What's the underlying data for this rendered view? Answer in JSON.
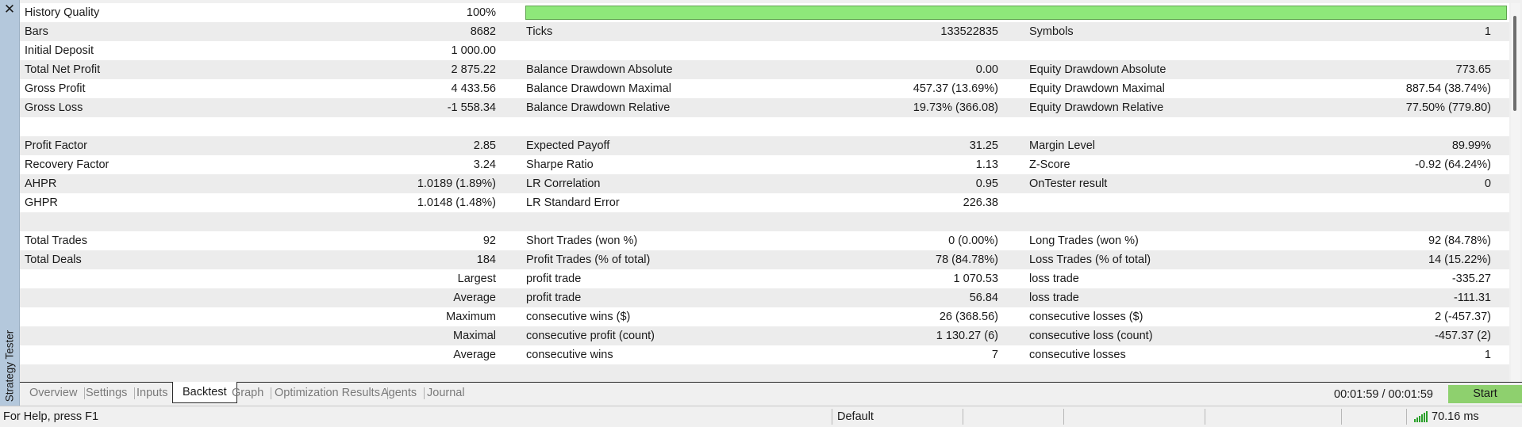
{
  "window": {
    "panel_title": "Strategy Tester",
    "close_glyph": "✕"
  },
  "report": {
    "rows": [
      {
        "l1": "History Quality",
        "v1": "100%",
        "l2": "",
        "v2": "",
        "l3": "",
        "v3": "",
        "bar": true,
        "quality_fraction": 1.0
      },
      {
        "l1": "Bars",
        "v1": "8682",
        "l2": "Ticks",
        "v2": "133522835",
        "l3": "Symbols",
        "v3": "1"
      },
      {
        "l1": "Initial Deposit",
        "v1": "1 000.00",
        "l2": "",
        "v2": "",
        "l3": "",
        "v3": ""
      },
      {
        "l1": "Total Net Profit",
        "v1": "2 875.22",
        "l2": "Balance Drawdown Absolute",
        "v2": "0.00",
        "l3": "Equity Drawdown Absolute",
        "v3": "773.65"
      },
      {
        "l1": "Gross Profit",
        "v1": "4 433.56",
        "l2": "Balance Drawdown Maximal",
        "v2": "457.37 (13.69%)",
        "l3": "Equity Drawdown Maximal",
        "v3": "887.54 (38.74%)"
      },
      {
        "l1": "Gross Loss",
        "v1": "-1 558.34",
        "l2": "Balance Drawdown Relative",
        "v2": "19.73% (366.08)",
        "l3": "Equity Drawdown Relative",
        "v3": "77.50% (779.80)"
      },
      {
        "l1": "",
        "v1": "",
        "l2": "",
        "v2": "",
        "l3": "",
        "v3": ""
      },
      {
        "l1": "Profit Factor",
        "v1": "2.85",
        "l2": "Expected Payoff",
        "v2": "31.25",
        "l3": "Margin Level",
        "v3": "89.99%"
      },
      {
        "l1": "Recovery Factor",
        "v1": "3.24",
        "l2": "Sharpe Ratio",
        "v2": "1.13",
        "l3": "Z-Score",
        "v3": "-0.92 (64.24%)"
      },
      {
        "l1": "AHPR",
        "v1": "1.0189 (1.89%)",
        "l2": "LR Correlation",
        "v2": "0.95",
        "l3": "OnTester result",
        "v3": "0"
      },
      {
        "l1": "GHPR",
        "v1": "1.0148 (1.48%)",
        "l2": "LR Standard Error",
        "v2": "226.38",
        "l3": "",
        "v3": ""
      },
      {
        "l1": "",
        "v1": "",
        "l2": "",
        "v2": "",
        "l3": "",
        "v3": ""
      },
      {
        "l1": "Total Trades",
        "v1": "92",
        "l2": "Short Trades (won %)",
        "v2": "0 (0.00%)",
        "l3": "Long Trades (won %)",
        "v3": "92 (84.78%)"
      },
      {
        "l1": "Total Deals",
        "v1": "184",
        "l2": "Profit Trades (% of total)",
        "v2": "78 (84.78%)",
        "l3": "Loss Trades (% of total)",
        "v3": "14 (15.22%)"
      },
      {
        "l1": "",
        "v1": "Largest",
        "l2": "profit trade",
        "v2": "1 070.53",
        "l3": "loss trade",
        "v3": "-335.27"
      },
      {
        "l1": "",
        "v1": "Average",
        "l2": "profit trade",
        "v2": "56.84",
        "l3": "loss trade",
        "v3": "-111.31"
      },
      {
        "l1": "",
        "v1": "Maximum",
        "l2": "consecutive wins ($)",
        "v2": "26 (368.56)",
        "l3": "consecutive losses ($)",
        "v3": "2 (-457.37)"
      },
      {
        "l1": "",
        "v1": "Maximal",
        "l2": "consecutive profit (count)",
        "v2": "1 130.27 (6)",
        "l3": "consecutive loss (count)",
        "v3": "-457.37 (2)"
      },
      {
        "l1": "",
        "v1": "Average",
        "l2": "consecutive wins",
        "v2": "7",
        "l3": "consecutive losses",
        "v3": "1"
      },
      {
        "l1": "",
        "v1": "",
        "l2": "",
        "v2": "",
        "l3": "",
        "v3": ""
      }
    ]
  },
  "tabs": [
    {
      "label": "Overview",
      "active": false
    },
    {
      "label": "Settings",
      "active": false
    },
    {
      "label": "Inputs",
      "active": false
    },
    {
      "label": "Backtest",
      "active": true
    },
    {
      "label": "Graph",
      "active": false
    },
    {
      "label": "Optimization Results",
      "active": false
    },
    {
      "label": "Agents",
      "active": false
    },
    {
      "label": "Journal",
      "active": false
    }
  ],
  "timer": "00:01:59 / 00:01:59",
  "start_button": "Start",
  "statusbar": {
    "help": "For Help, press F1",
    "profile": "Default",
    "ping": "70.16 ms"
  },
  "colors": {
    "quality_bar": "#8ee87a",
    "start_button": "#8ed06e",
    "sidebar": "#b4c8dc",
    "signal": "#2aa02a"
  },
  "icons": {
    "close": "close-icon",
    "connection": "signal-bars-icon"
  }
}
